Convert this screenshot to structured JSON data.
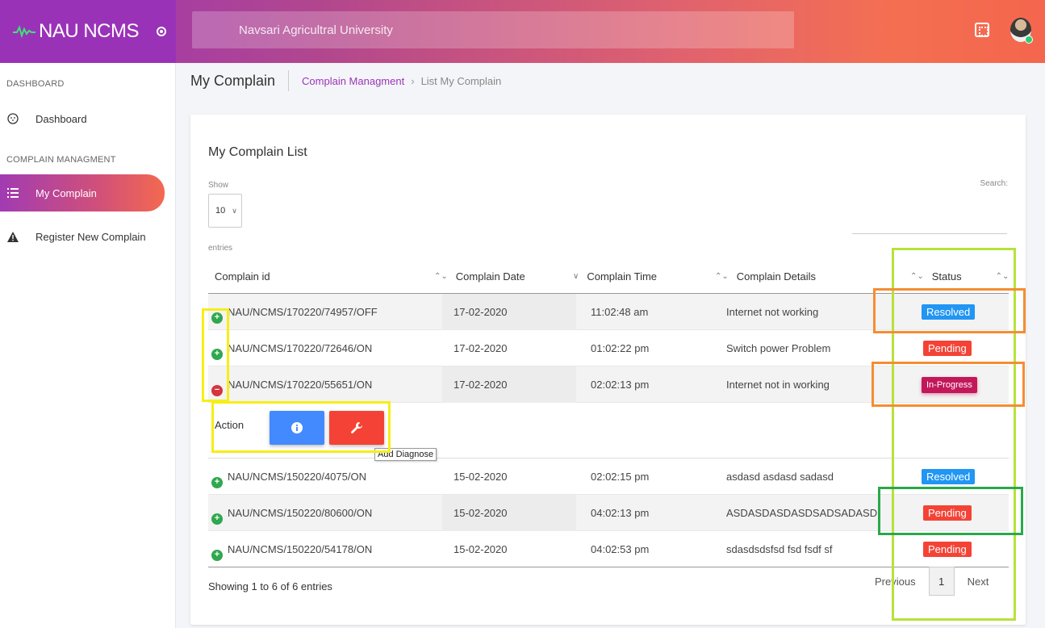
{
  "header": {
    "brand": "NAU NCMS",
    "search_text": "Navsari Agricultral University"
  },
  "sidebar": {
    "section1": "DASHBOARD",
    "dashboard": "Dashboard",
    "section2": "COMPLAIN MANAGMENT",
    "my_complain": "My Complain",
    "register": "Register New Complain"
  },
  "breadcrumb": {
    "page_title": "My Complain",
    "link": "Complain Managment",
    "separator": "›",
    "current": "List My Complain"
  },
  "card": {
    "title": "My Complain List",
    "show": "Show",
    "length_value": "10",
    "entries": "entries",
    "search_label": "Search:"
  },
  "table": {
    "headers": [
      "Complain id",
      "Complain Date",
      "Complain Time",
      "Complain Details",
      "Status"
    ],
    "rows": [
      {
        "id": "NAU/NCMS/170220/74957/OFF",
        "date": "17-02-2020",
        "time": "11:02:48 am",
        "details": "Internet not working",
        "status": "Resolved"
      },
      {
        "id": "NAU/NCMS/170220/72646/ON",
        "date": "17-02-2020",
        "time": "01:02:22 pm",
        "details": "Switch power Problem",
        "status": "Pending"
      },
      {
        "id": "NAU/NCMS/170220/55651/ON",
        "date": "17-02-2020",
        "time": "02:02:13 pm",
        "details": "Internet not in working",
        "status": "In-Progress"
      },
      {
        "id": "NAU/NCMS/150220/4075/ON",
        "date": "15-02-2020",
        "time": "02:02:15 pm",
        "details": "asdasd asdasd sadasd",
        "status": "Resolved"
      },
      {
        "id": "NAU/NCMS/150220/80600/ON",
        "date": "15-02-2020",
        "time": "04:02:13 pm",
        "details": "ASDASDASDASDSADSADASD",
        "status": "Pending"
      },
      {
        "id": "NAU/NCMS/150220/54178/ON",
        "date": "15-02-2020",
        "time": "04:02:53 pm",
        "details": "sdasdsdsfsd fsd fsdf sf",
        "status": "Pending"
      }
    ],
    "action_label": "Action",
    "tooltip": "Add Diagnose"
  },
  "footer": {
    "info": "Showing 1 to 6 of 6 entries",
    "previous": "Previous",
    "page": "1",
    "next": "Next"
  },
  "colors": {
    "brand_purple": "#9a32b8",
    "accent_orange": "#f46f52",
    "resolved": "#2196f3",
    "pending": "#f44336",
    "in_progress": "#c2185b"
  }
}
